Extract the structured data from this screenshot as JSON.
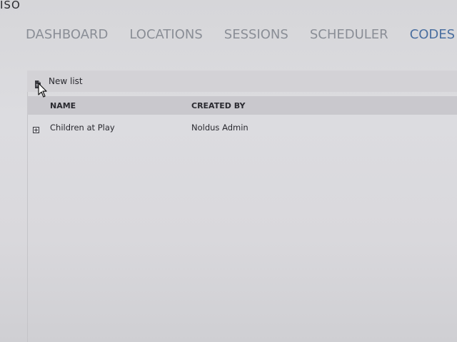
{
  "app": {
    "title": "ISO"
  },
  "nav": {
    "items": [
      {
        "label": "DASHBOARD",
        "active": false
      },
      {
        "label": "LOCATIONS",
        "active": false
      },
      {
        "label": "SESSIONS",
        "active": false
      },
      {
        "label": "SCHEDULER",
        "active": false
      },
      {
        "label": "CODES",
        "active": true
      }
    ]
  },
  "toolbar": {
    "new_list_label": "New list",
    "new_list_icon": "document-icon"
  },
  "table": {
    "columns": [
      "NAME",
      "CREATED BY"
    ],
    "rows": [
      {
        "name": "Children at Play",
        "created_by": "Noldus Admin",
        "expand_icon": "plus-box-icon"
      }
    ]
  },
  "colors": {
    "active_nav": "#4a6fa0",
    "inactive_nav": "#8a8e96",
    "text": "#2a2a30"
  }
}
